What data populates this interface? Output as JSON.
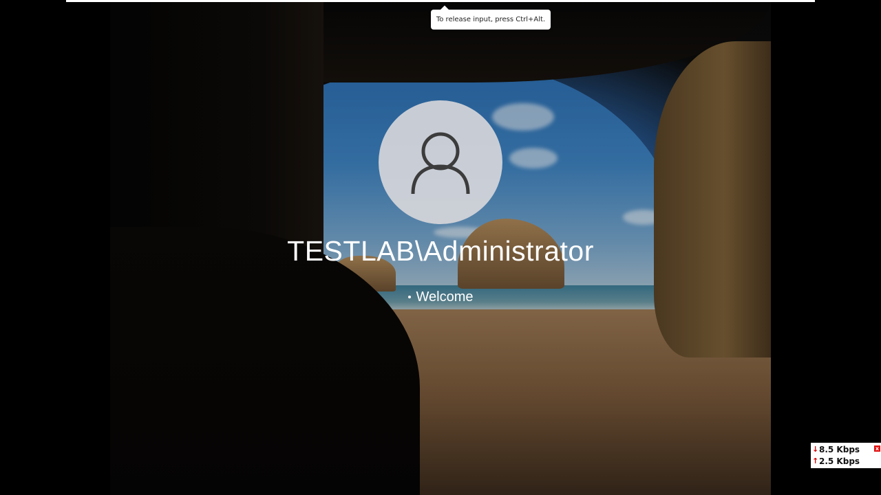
{
  "tooltip": {
    "text": "To release input, press Ctrl+Alt."
  },
  "login": {
    "username": "TESTLAB\\Administrator",
    "status": "Welcome",
    "avatar_icon": "user-icon"
  },
  "network": {
    "download": "8.5 Kbps",
    "upload": "2.5 Kbps",
    "download_arrow": "↓",
    "upload_arrow": "↑",
    "close": "x"
  },
  "colors": {
    "avatar_bg": "#d6d6da",
    "text": "#ffffff",
    "net_arrow": "#d40000"
  }
}
